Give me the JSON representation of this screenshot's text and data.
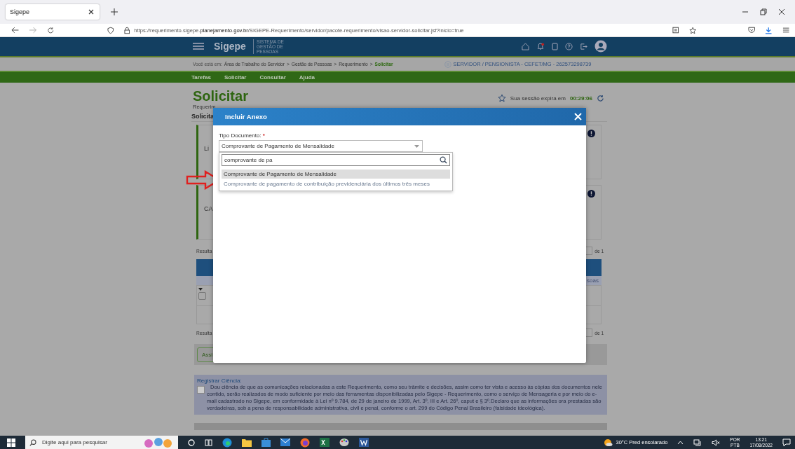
{
  "browser": {
    "tab_title": "Sigepe",
    "url_prefix": "https://requerimento.sigepe.",
    "url_domain": "planejamento.gov.br",
    "url_path": "/SIGEPE-Requerimento/servidor/pacote-requerimento/visao-servidor-solicitar.jsf?inicio=true"
  },
  "header": {
    "logo": "Sigepe",
    "logo_subtitle": "SISTEMA DE GESTÃO DE PESSOAS"
  },
  "breadcrumb": {
    "prefix": "Você está em:",
    "separator": ">",
    "user": "SERVIDOR / PENSIONISTA - CEFET/MG - 262573298739",
    "items": [
      {
        "label": "Área de Trabalho do Servidor",
        "current": false
      },
      {
        "label": "Gestão de Pessoas",
        "current": false
      },
      {
        "label": "Requerimento",
        "current": false
      },
      {
        "label": "Solicitar",
        "current": true
      }
    ]
  },
  "nav": [
    "Tarefas",
    "Solicitar",
    "Consultar",
    "Ajuda"
  ],
  "page": {
    "title": "Solicitar",
    "subtitle": "Requerim",
    "section": "Solicita",
    "session_label": "Sua sessão expira em",
    "session_time": "00:29:06",
    "cards": [
      "Li",
      "CA"
    ],
    "results": [
      "Resulta",
      "Resulta"
    ],
    "pagers": [
      "de 1",
      "de 1"
    ],
    "table_fragment": "soas",
    "row_checked": false,
    "button_fragment": "Assi"
  },
  "modal": {
    "title": "Incluir Anexo",
    "field_label": "Tipo Documento:",
    "required_mark": "*",
    "field_value": "Comprovante de Pagamento de Mensalidade",
    "search_value": "comprovante de pa",
    "options": [
      {
        "label": "Comprovante de Pagamento de Mensalidade",
        "selected": true
      },
      {
        "label": "Comprovante de pagamento de contribuição previdenciária dos últimos três meses",
        "selected": false
      }
    ]
  },
  "ciencia": {
    "title": "Registrar Ciência:",
    "checked": false,
    "text": "Dou ciência de que as comunicações relacionadas a este Requerimento, como seu trâmite e decisões, assim como ter vista e acesso às cópias dos documentos nele contido, serão realizados de modo suficiente por meio das ferramentas disponibilizadas pelo Sigepe - Requerimento, como o serviço de Mensageria e por meio do e-mail cadastrado no Sigepe, em conformidade à Lei nº 9.784, de 29 de janeiro de 1999, Art. 3º, III e Art. 26º, caput e § 3º.Declaro que as informações ora prestadas são verdadeiras, sob a pena de responsabilidade administrativa, civil e penal, conforme o art. 299 do Código Penal Brasileiro (falsidade ideológica)."
  },
  "taskbar": {
    "search_placeholder": "Digite aqui para pesquisar",
    "weather": "30°C Pred ensolarado",
    "language": [
      "POR",
      "PTB"
    ],
    "time": "13:21",
    "date": "17/08/2022"
  }
}
